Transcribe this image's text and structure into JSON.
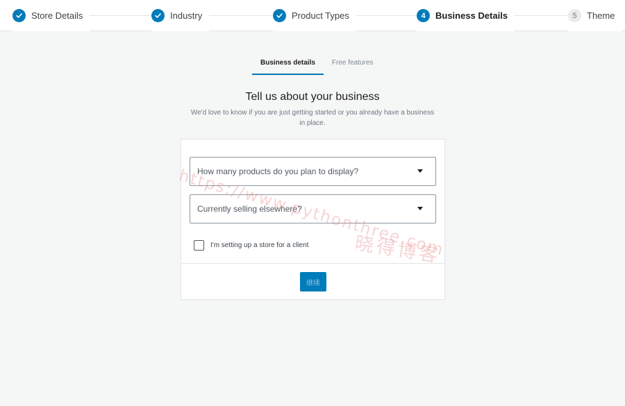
{
  "stepper": {
    "steps": [
      {
        "label": "Store Details",
        "state": "done"
      },
      {
        "label": "Industry",
        "state": "done"
      },
      {
        "label": "Product Types",
        "state": "done"
      },
      {
        "label": "Business Details",
        "state": "current",
        "number": "4"
      },
      {
        "label": "Theme",
        "state": "todo",
        "number": "5"
      }
    ]
  },
  "tabs": [
    {
      "label": "Business details",
      "active": true
    },
    {
      "label": "Free features",
      "active": false
    }
  ],
  "main": {
    "title": "Tell us about your business",
    "subtitle": "We'd love to know if you are just getting started or you already have a business in place."
  },
  "form": {
    "products_select": {
      "placeholder": "How many products do you plan to display?"
    },
    "selling_select": {
      "placeholder": "Currently selling elsewhere?"
    },
    "client_checkbox": {
      "label": "I'm setting up a store for a client",
      "checked": false
    },
    "continue_label": "继续"
  },
  "watermark": {
    "url": "https://www.pythonthree.com",
    "brand": "晓得博客"
  },
  "colors": {
    "accent": "#007cba",
    "background": "#f5f6f6"
  }
}
